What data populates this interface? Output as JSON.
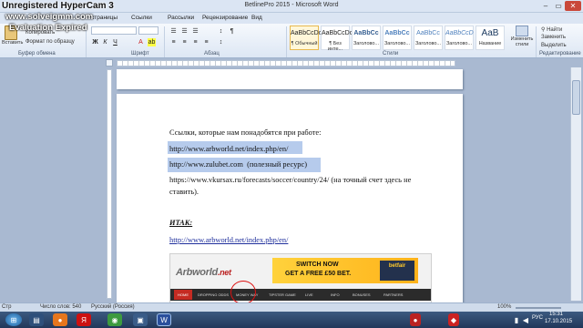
{
  "watermark": {
    "line1": "Unregistered HyperCam 3",
    "line2": "www.solveigmm.com",
    "line3": "Evaluation Expired"
  },
  "window": {
    "title": "BetlinePro 2015 - Microsoft Word"
  },
  "tabs": [
    {
      "label": "страницы"
    },
    {
      "label": "Ссылки"
    },
    {
      "label": "Рассылки"
    },
    {
      "label": "Рецензирование"
    },
    {
      "label": "Вид"
    }
  ],
  "ribbon": {
    "clipboard": {
      "insert": "Вставить",
      "copy": "Копировать",
      "format_painter": "Формат по образцу",
      "label": "Буфер обмена"
    },
    "font_label": "Шрифт",
    "paragraph_label": "Абзац",
    "styles_label": "Стили",
    "styles": [
      {
        "sample": "AaBbCcDc",
        "name": "¶ Обычный"
      },
      {
        "sample": "AaBbCcDc",
        "name": "¶ Без инте..."
      },
      {
        "sample": "AaBbCc",
        "name": "Заголово..."
      },
      {
        "sample": "AaBbCc",
        "name": "Заголово..."
      },
      {
        "sample": "AaBbCc",
        "name": "Заголово..."
      },
      {
        "sample": "AaBbCcD",
        "name": "Заголово..."
      },
      {
        "sample": "AaB",
        "name": "Название"
      }
    ],
    "change_styles": "Изменить стили",
    "editing": {
      "find": "Найти",
      "replace": "Заменить",
      "select": "Выделить",
      "label": "Редактирование"
    }
  },
  "document": {
    "intro": "Ссылки, которые нам понадобятся при работе:",
    "link1": "http://www.arbworld.net/index.php/en/",
    "link2": "http://www.zulubet.com",
    "link2_note": "(полезный ресурс)",
    "link3": "https://www.vkursax.ru/forecasts/soccer/country/24/ (на точный счет здесь не",
    "link3_cont": "ставить).",
    "heading": "ИТАК:",
    "link4": "http://www.arbworld.net/index.php/en/"
  },
  "embedded_site": {
    "logo": "Arbworld",
    "logo_suffix": ".net",
    "banner_line1": "SWITCH NOW",
    "banner_line2": "GET A FREE £50 BET.",
    "betfair": "betfair",
    "nav": [
      "HOME",
      "DROPPING ODDS",
      "MONEY WAY",
      "TIPSTER GAME",
      "LIVE",
      "INFO",
      "BONUSES",
      "PARTNERS"
    ]
  },
  "statusbar": {
    "page": "Стр",
    "words": "Число слов: 540",
    "language": "Русский (Россия)",
    "zoom": "100%"
  },
  "taskbar": {
    "lang": "РУС",
    "time": "15:31",
    "date": "17.10.2015"
  }
}
